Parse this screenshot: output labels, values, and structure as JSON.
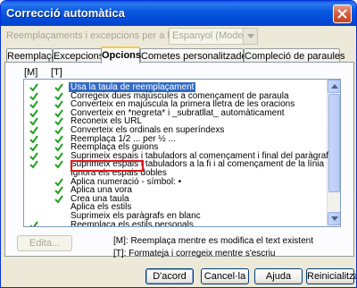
{
  "window": {
    "title": "Correcció automàtica"
  },
  "language": {
    "label": "Reemplaçaments i excepcions per a la llengua:",
    "selected": "Espanyol (Modern)"
  },
  "tabs": [
    {
      "label": "Reemplaça"
    },
    {
      "label": "Excepcions"
    },
    {
      "label": "Opcions",
      "active": true
    },
    {
      "label": "Cometes personalitzades"
    },
    {
      "label": "Compleció de paraules"
    }
  ],
  "list": {
    "col_m": "[M]",
    "col_t": "[T]",
    "items": [
      {
        "m": true,
        "t": true,
        "text": "Usa la taula de reemplaçament",
        "selected": true
      },
      {
        "m": true,
        "t": true,
        "text": "Corregeix dues majúscules a començament de paraula"
      },
      {
        "m": true,
        "t": true,
        "text": "Converteix en majúscula la primera lletra de les oracions"
      },
      {
        "m": true,
        "t": true,
        "text": "Converteix en *negreta* i _subratllat_ automàticament"
      },
      {
        "m": true,
        "t": true,
        "text": "Reconeix els URL"
      },
      {
        "m": true,
        "t": true,
        "text": "Converteix els ordinals en superíndexs"
      },
      {
        "m": true,
        "t": true,
        "text": "Reemplaça 1/2 ... per ½ ..."
      },
      {
        "m": true,
        "t": true,
        "text": "Reemplaça els guions"
      },
      {
        "m": true,
        "t": true,
        "text": "Suprimeix espais i tabuladors al començament i final del paràgraf"
      },
      {
        "m": true,
        "t": true,
        "text": "Suprimeix espais i tabuladors a la fi i al començament de la línia"
      },
      {
        "m": false,
        "t": false,
        "text": "Ignora els espais dobles"
      },
      {
        "m": false,
        "t": true,
        "text": "Aplica numeració - símbol: •"
      },
      {
        "m": false,
        "t": true,
        "text": "Aplica una vora"
      },
      {
        "m": false,
        "t": true,
        "text": "Crea una taula"
      },
      {
        "m": false,
        "t": false,
        "text": "Aplica els estils"
      },
      {
        "m": false,
        "t": false,
        "text": "Suprimeix els paràgrafs en blanc"
      },
      {
        "m": true,
        "t": false,
        "text": "Reemplaça els estils personals"
      }
    ]
  },
  "edit_button": "Edita...",
  "legend": {
    "m": "[M]: Reemplaça mentre es modifica el text existent",
    "t": "[T]: Formateja i corregeix mentre s'escriu"
  },
  "buttons": {
    "ok": "D'acord",
    "cancel": "Cancel·la",
    "help": "Ajuda",
    "reset": "Reinicialitza"
  },
  "colors": {
    "title_bar": "#0a5be0",
    "highlight": "#e01818",
    "selection": "#316ac5"
  }
}
